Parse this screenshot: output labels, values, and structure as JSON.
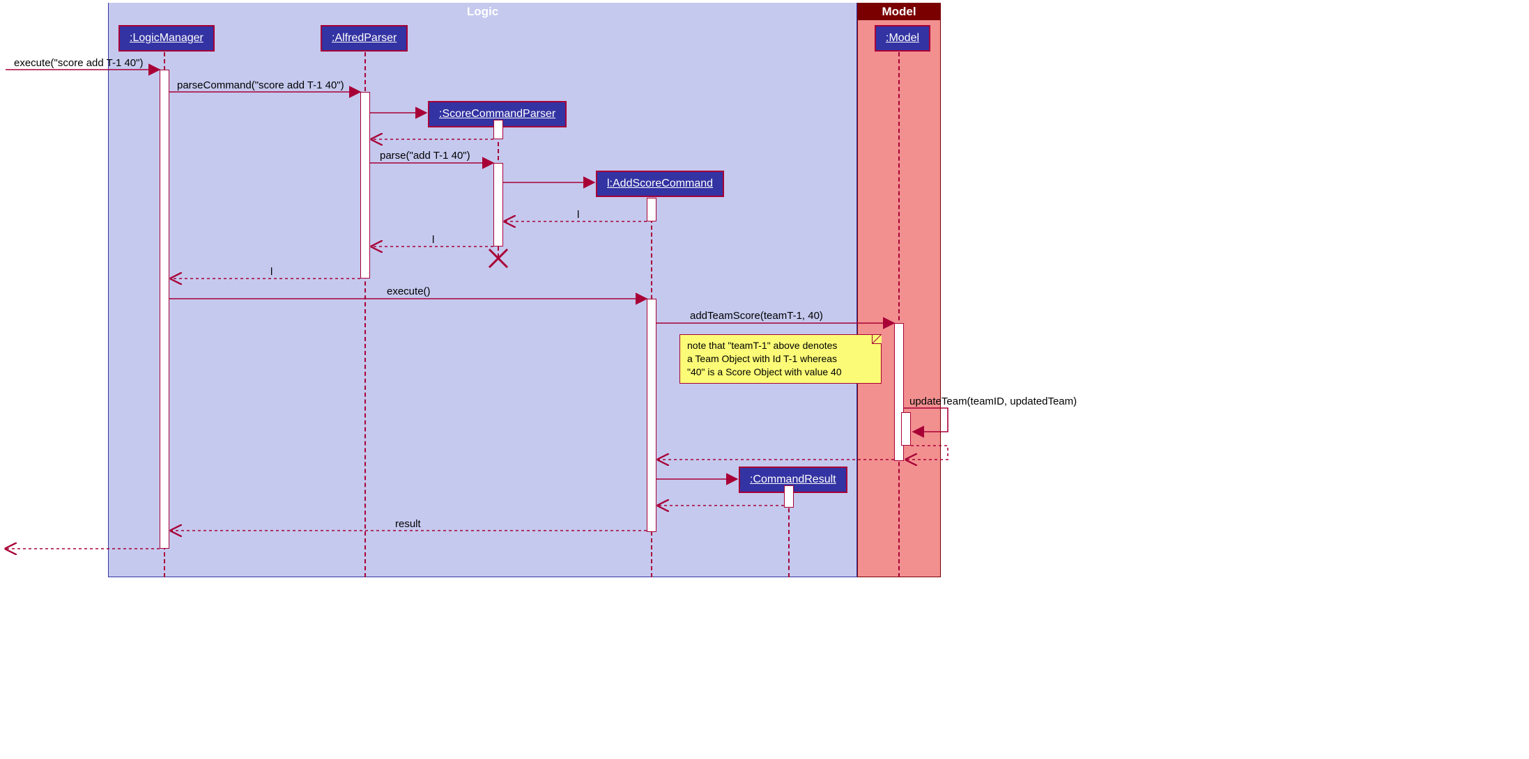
{
  "frames": {
    "logic": {
      "title": "Logic"
    },
    "model": {
      "title": "Model"
    }
  },
  "participants": {
    "logicManager": ":LogicManager",
    "alfredParser": ":AlfredParser",
    "scoreCommandParser": ":ScoreCommandParser",
    "addScoreCommand": "l:AddScoreCommand",
    "commandResult": ":CommandResult",
    "model": ":Model"
  },
  "messages": {
    "m1": "execute(\"score add T-1 40\")",
    "m2": "parseCommand(\"score add T-1 40\")",
    "m3": "parse(\"add T-1 40\")",
    "m4": "l",
    "m5": "l",
    "m6": "l",
    "m7": "execute()",
    "m8": "addTeamScore(teamT-1, 40)",
    "m9": "updateTeam(teamID, updatedTeam)",
    "m10": "result"
  },
  "note": {
    "l1": "note that \"teamT-1\" above denotes",
    "l2": "a Team Object with Id T-1 whereas",
    "l3": "\"40\" is a Score Object with value 40"
  },
  "chart_data": {
    "type": "uml-sequence",
    "boxes": [
      {
        "name": "Logic",
        "participants": [
          ":LogicManager",
          ":AlfredParser",
          ":ScoreCommandParser",
          "l:AddScoreCommand",
          ":CommandResult"
        ]
      },
      {
        "name": "Model",
        "participants": [
          ":Model"
        ]
      }
    ],
    "messages": [
      {
        "from": "external",
        "to": ":LogicManager",
        "text": "execute(\"score add T-1 40\")",
        "kind": "sync"
      },
      {
        "from": ":LogicManager",
        "to": ":AlfredParser",
        "text": "parseCommand(\"score add T-1 40\")",
        "kind": "sync"
      },
      {
        "from": ":AlfredParser",
        "to": ":ScoreCommandParser",
        "text": "",
        "kind": "create"
      },
      {
        "from": ":ScoreCommandParser",
        "to": ":AlfredParser",
        "text": "",
        "kind": "return"
      },
      {
        "from": ":AlfredParser",
        "to": ":ScoreCommandParser",
        "text": "parse(\"add T-1 40\")",
        "kind": "sync"
      },
      {
        "from": ":ScoreCommandParser",
        "to": "l:AddScoreCommand",
        "text": "",
        "kind": "create"
      },
      {
        "from": "l:AddScoreCommand",
        "to": ":ScoreCommandParser",
        "text": "l",
        "kind": "return"
      },
      {
        "from": ":ScoreCommandParser",
        "to": ":AlfredParser",
        "text": "l",
        "kind": "return"
      },
      {
        "from": ":ScoreCommandParser",
        "to": null,
        "text": "",
        "kind": "destroy"
      },
      {
        "from": ":AlfredParser",
        "to": ":LogicManager",
        "text": "l",
        "kind": "return"
      },
      {
        "from": ":LogicManager",
        "to": "l:AddScoreCommand",
        "text": "execute()",
        "kind": "sync"
      },
      {
        "from": "l:AddScoreCommand",
        "to": ":Model",
        "text": "addTeamScore(teamT-1, 40)",
        "kind": "sync"
      },
      {
        "from": ":Model",
        "to": ":Model",
        "text": "updateTeam(teamID, updatedTeam)",
        "kind": "self-sync"
      },
      {
        "from": ":Model",
        "to": "l:AddScoreCommand",
        "text": "",
        "kind": "return"
      },
      {
        "from": "l:AddScoreCommand",
        "to": ":CommandResult",
        "text": "",
        "kind": "create"
      },
      {
        "from": ":CommandResult",
        "to": "l:AddScoreCommand",
        "text": "",
        "kind": "return"
      },
      {
        "from": "l:AddScoreCommand",
        "to": ":LogicManager",
        "text": "result",
        "kind": "return"
      },
      {
        "from": ":LogicManager",
        "to": "external",
        "text": "",
        "kind": "return"
      }
    ],
    "note": "note that \"teamT-1\" above denotes a Team Object with Id T-1 whereas \"40\" is a Score Object with value 40"
  }
}
